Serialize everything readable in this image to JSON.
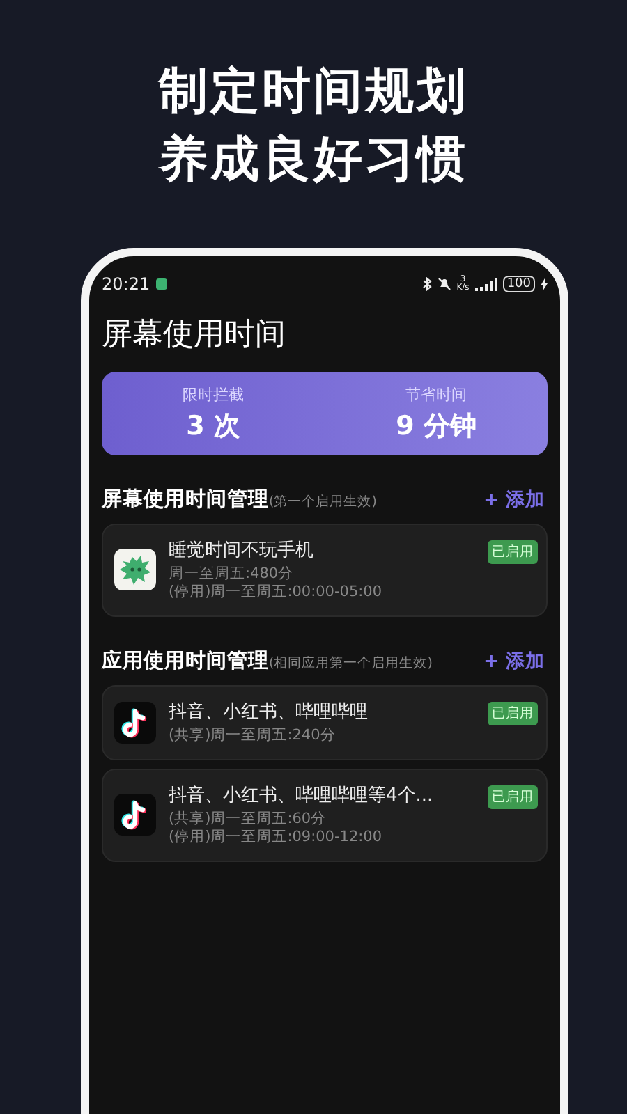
{
  "headline": [
    "制定时间规划",
    "养成良好习惯"
  ],
  "status_bar": {
    "time": "20:21",
    "net_speed_value": "3",
    "net_speed_unit": "K/s",
    "battery": "100"
  },
  "title": "屏幕使用时间",
  "summary": [
    {
      "label": "限时拦截",
      "value": "3 次"
    },
    {
      "label": "节省时间",
      "value": "9 分钟"
    }
  ],
  "sections": [
    {
      "title": "屏幕使用时间管理",
      "note": "(第一个启用生效)",
      "add": "+ 添加",
      "rules": [
        {
          "name": "睡觉时间不玩手机",
          "lines": [
            "周一至周五:480分",
            "(停用)周一至周五:00:00-05:00"
          ],
          "badge": "已启用"
        }
      ]
    },
    {
      "title": "应用使用时间管理",
      "note": "(相同应用第一个启用生效)",
      "add": "+ 添加",
      "rules": [
        {
          "name": "抖音、小红书、哔哩哔哩",
          "lines": [
            "(共享)周一至周五:240分"
          ],
          "badge": "已启用"
        },
        {
          "name": "抖音、小红书、哔哩哔哩等4个...",
          "lines": [
            "(共享)周一至周五:60分",
            "(停用)周一至周五:09:00-12:00"
          ],
          "badge": "已启用"
        }
      ]
    }
  ]
}
